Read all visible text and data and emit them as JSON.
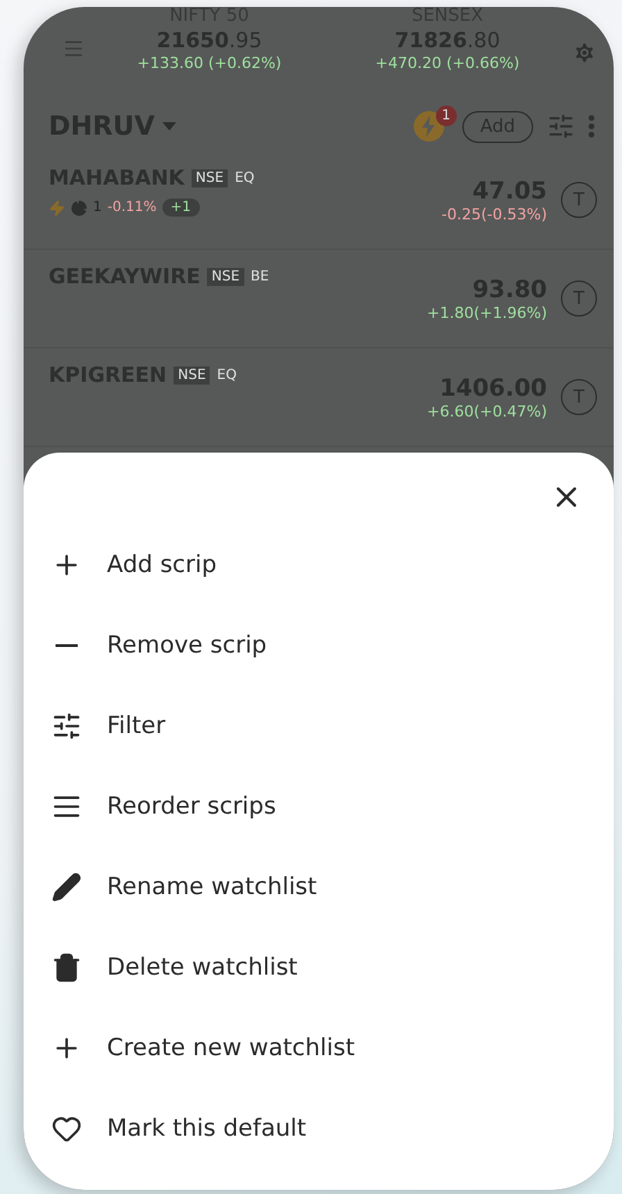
{
  "indices": [
    {
      "name": "NIFTY 50",
      "price_main": "21650",
      "price_decimals": ".95",
      "change": "+133.60  (+0.62%)",
      "color": "#9fe09f"
    },
    {
      "name": "SENSEX",
      "price_main": "71826",
      "price_decimals": ".80",
      "change": "+470.20 (+0.66%)",
      "color": "#9fe09f"
    }
  ],
  "watchlist": {
    "name": "DHRUV",
    "alert_count": "1",
    "add_button": "Add"
  },
  "scrips": [
    {
      "symbol": "MAHABANK",
      "exchange": "NSE",
      "series": "EQ",
      "price": "47.05",
      "change": "-0.25(-0.53%)",
      "color": "#f2a3a3",
      "holding": {
        "quantity": "1",
        "pnl": "-0.11%",
        "color": "#f2a3a3",
        "extra": "+1"
      },
      "trade_label": "T"
    },
    {
      "symbol": "GEEKAYWIRE",
      "exchange": "NSE",
      "series": "BE",
      "price": "93.80",
      "change": "+1.80(+1.96%)",
      "color": "#9fe09f",
      "trade_label": "T"
    },
    {
      "symbol": "KPIGREEN",
      "exchange": "NSE",
      "series": "EQ",
      "price": "1406.00",
      "change": "+6.60(+0.47%)",
      "color": "#9fe09f",
      "trade_label": "T"
    }
  ],
  "menu": [
    {
      "kind": "add",
      "label": "Add scrip"
    },
    {
      "kind": "remove",
      "label": "Remove scrip"
    },
    {
      "kind": "filter",
      "label": "Filter"
    },
    {
      "kind": "reorder",
      "label": "Reorder scrips"
    },
    {
      "kind": "rename",
      "label": "Rename watchlist"
    },
    {
      "kind": "delete",
      "label": "Delete watchlist"
    },
    {
      "kind": "create",
      "label": "Create new watchlist"
    },
    {
      "kind": "default",
      "label": "Mark this default"
    }
  ]
}
